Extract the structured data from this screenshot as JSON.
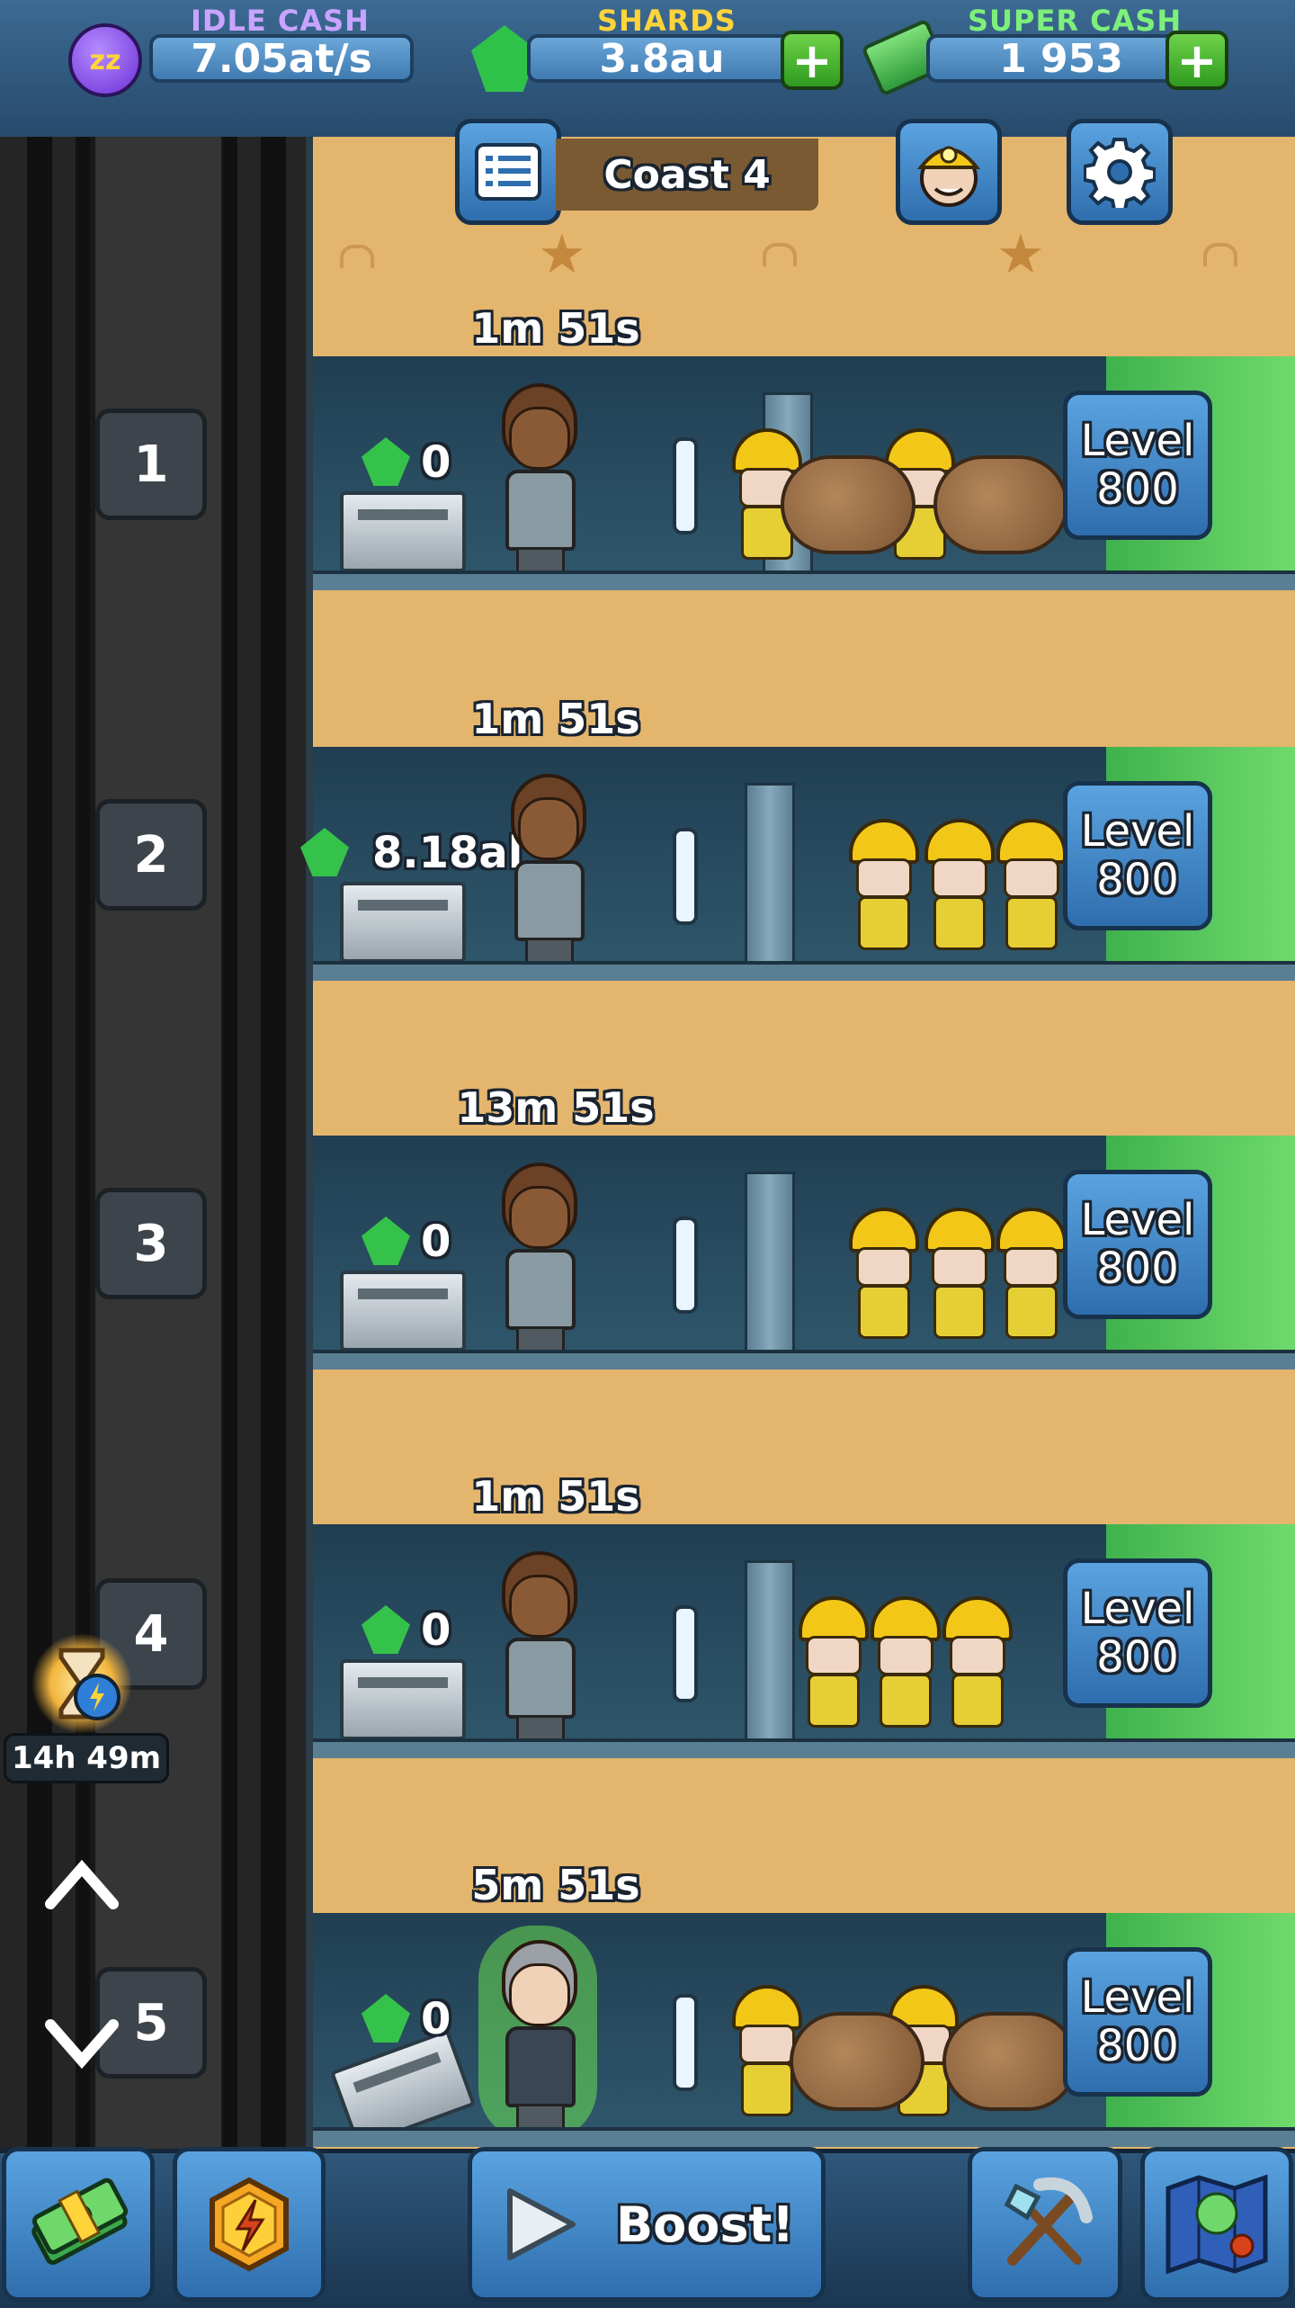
{
  "top_bar": {
    "idle_cash": {
      "label": "IDLE CASH",
      "value": "7.05at/s"
    },
    "shards": {
      "label": "SHARDS",
      "value": "3.8au"
    },
    "super_cash": {
      "label": "SUPER CASH",
      "value": "1 953"
    }
  },
  "header": {
    "mine_name": "Coast 4",
    "icons": {
      "menu": "list-icon",
      "manager": "manager-portrait-icon",
      "settings": "gear-icon"
    }
  },
  "shafts": [
    {
      "number": "1",
      "timer": "1m 51s",
      "stock": "0",
      "level_label": "Level",
      "level": "800"
    },
    {
      "number": "2",
      "timer": "1m 51s",
      "stock": "8.18al",
      "level_label": "Level",
      "level": "800"
    },
    {
      "number": "3",
      "timer": "13m 51s",
      "stock": "0",
      "level_label": "Level",
      "level": "800"
    },
    {
      "number": "4",
      "timer": "1m 51s",
      "stock": "0",
      "level_label": "Level",
      "level": "800"
    },
    {
      "number": "5",
      "timer": "5m 51s",
      "stock": "0",
      "level_label": "Level",
      "level": "800"
    }
  ],
  "boost_timer": "14h 49m",
  "bottom_bar": {
    "boost_label": "Boost!",
    "icons": [
      "cash-stack-icon",
      "lightning-coin-icon",
      "play-icon",
      "pickaxe-shovel-icon",
      "map-icon"
    ]
  },
  "colors": {
    "idle_cash_title": "#c9a4ff",
    "shards_title": "#ffd43a",
    "super_cash_title": "#7df07a",
    "sand": "#e4b56d",
    "ore": "#4cc45a"
  }
}
